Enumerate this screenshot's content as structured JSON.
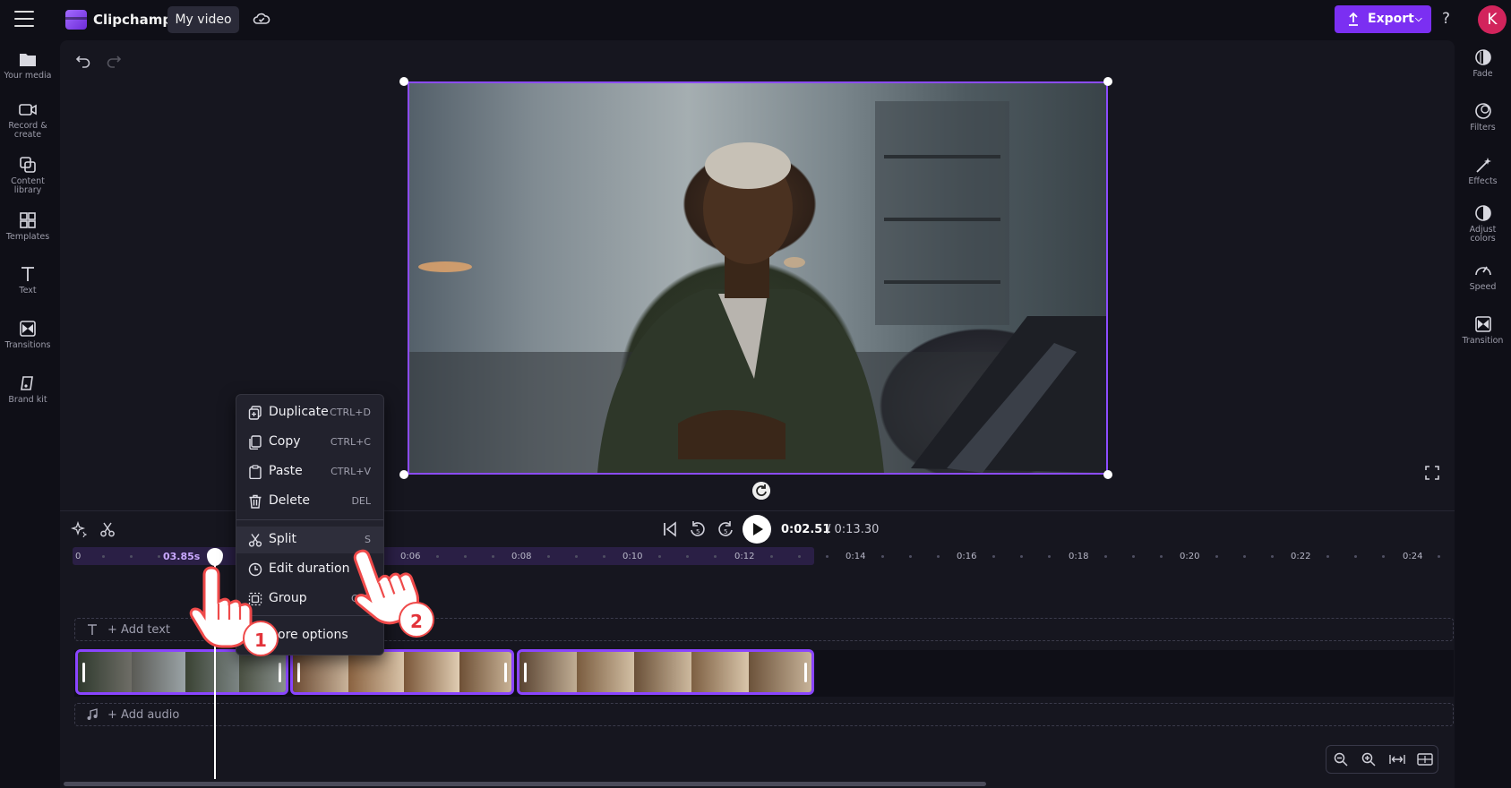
{
  "app": {
    "brand": "Clipchamp",
    "project_tab": "My video"
  },
  "header": {
    "export_label": "Export",
    "help": "?",
    "avatar_initial": "K"
  },
  "left_sidebar": [
    {
      "id": "your-media",
      "label": "Your media",
      "icon": "folder-icon"
    },
    {
      "id": "record-create",
      "label": "Record & create",
      "icon": "camera-icon"
    },
    {
      "id": "content-library",
      "label": "Content library",
      "icon": "library-icon"
    },
    {
      "id": "templates",
      "label": "Templates",
      "icon": "templates-icon"
    },
    {
      "id": "text",
      "label": "Text",
      "icon": "text-icon"
    },
    {
      "id": "transitions",
      "label": "Transitions",
      "icon": "transitions-icon"
    },
    {
      "id": "brand-kit",
      "label": "Brand kit",
      "icon": "brand-kit-icon"
    }
  ],
  "right_sidebar": [
    {
      "id": "fade",
      "label": "Fade",
      "icon": "fade-icon"
    },
    {
      "id": "filters",
      "label": "Filters",
      "icon": "filters-icon"
    },
    {
      "id": "effects",
      "label": "Effects",
      "icon": "effects-icon"
    },
    {
      "id": "adjust-colors",
      "label": "Adjust colors",
      "icon": "adjust-colors-icon"
    },
    {
      "id": "speed",
      "label": "Speed",
      "icon": "speed-icon"
    },
    {
      "id": "transition",
      "label": "Transition",
      "icon": "transition-icon"
    }
  ],
  "playback": {
    "current_time": "0:02.51",
    "total_time": "/ 0:13.30"
  },
  "timeline": {
    "playhead_label": "03.85s",
    "ruler": [
      "0",
      "0:06",
      "0:08",
      "0:10",
      "0:12",
      "0:14",
      "0:16",
      "0:18",
      "0:20",
      "0:22",
      "0:24"
    ],
    "add_text": "+ Add text",
    "add_audio": "+ Add audio"
  },
  "context_menu": [
    {
      "label": "Duplicate",
      "shortcut": "CTRL+D",
      "icon": "duplicate-icon"
    },
    {
      "label": "Copy",
      "shortcut": "CTRL+C",
      "icon": "copy-icon"
    },
    {
      "label": "Paste",
      "shortcut": "CTRL+V",
      "icon": "paste-icon"
    },
    {
      "label": "Delete",
      "shortcut": "DEL",
      "icon": "delete-icon"
    },
    {
      "label": "Split",
      "shortcut": "S",
      "icon": "split-icon"
    },
    {
      "label": "Edit duration",
      "shortcut": "",
      "icon": "clock-icon"
    },
    {
      "label": "Group",
      "shortcut": "CTR",
      "icon": "group-icon"
    },
    {
      "label": "ore options",
      "shortcut": "",
      "icon": ""
    }
  ],
  "annotations": {
    "step1": "1",
    "step2": "2"
  },
  "colors": {
    "accent": "#7b2ff2",
    "clip_border": "#8a45ff",
    "badge_border": "#ef4a4a"
  }
}
